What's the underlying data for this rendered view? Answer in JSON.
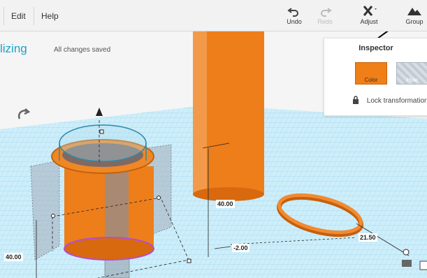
{
  "menu": {
    "edit": "Edit",
    "help": "Help"
  },
  "toolbar": {
    "undo": "Undo",
    "redo": "Redo",
    "adjust": "Adjust",
    "group": "Group"
  },
  "project": {
    "title_fragment": "lizing",
    "save_status": "All changes saved"
  },
  "inspector": {
    "title": "Inspector",
    "color_label": "Color",
    "hole_label": "Hole",
    "lock_label": "Lock transformation",
    "color_value": "#f07f17"
  },
  "dimensions": {
    "cylinder_height": "40.00",
    "offset": "-2.00",
    "ring_width": "21.50",
    "left_height": "40.00"
  },
  "colors": {
    "accent": "#1aa3c8",
    "shape_orange": "#f07f17",
    "grid": "#bfe6f4"
  }
}
